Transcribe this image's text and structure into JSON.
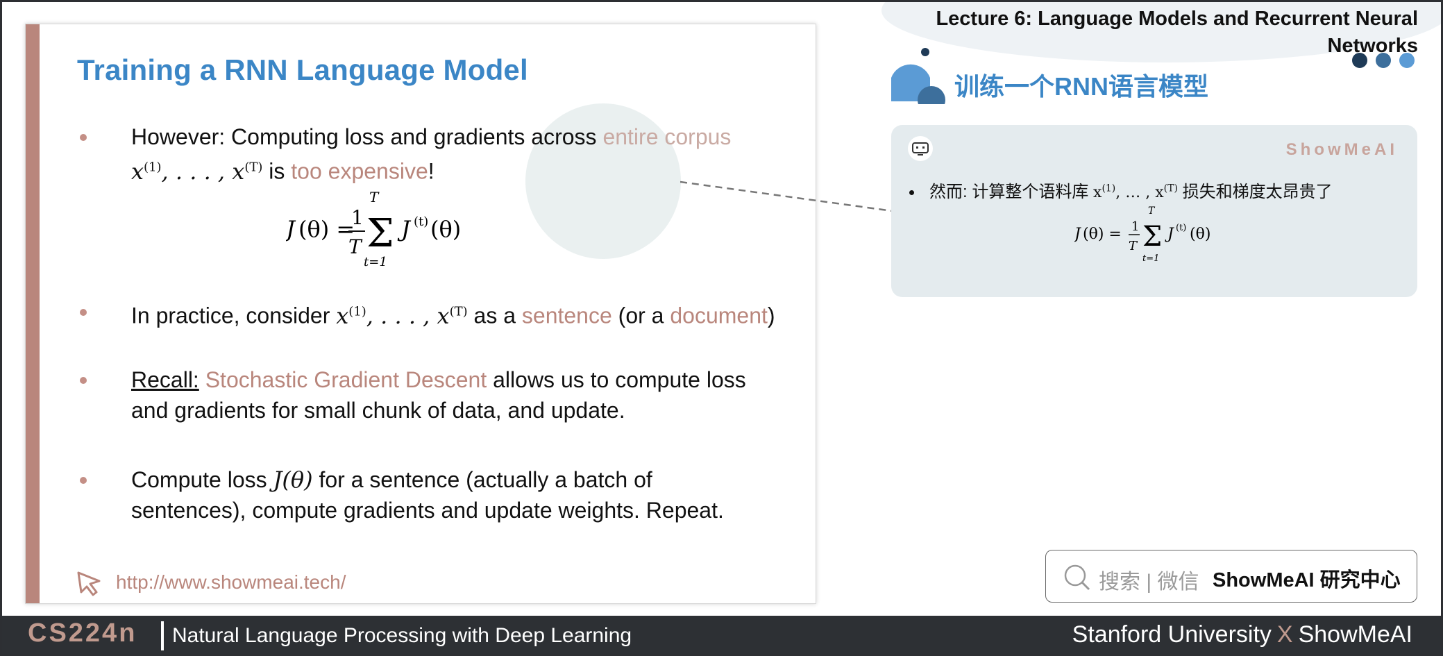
{
  "slide": {
    "title": "Training a RNN Language Model",
    "bullet1": {
      "line1_prefix": "However: Computing loss and gradients across ",
      "line1_highlight": "entire corpus",
      "line2_math": "x(1), . . . , x(T)",
      "line2_mid": " is ",
      "line2_highlight": "too expensive",
      "line2_end": "!"
    },
    "formula": "J(θ) = 1/T Σ_{t=1}^{T} J^{(t)}(θ)",
    "bullet2": {
      "prefix": "In practice, consider ",
      "math": "x(1), . . . , x(T)",
      "mid": " as a ",
      "highlight1": "sentence",
      "mid2": " (or a ",
      "highlight2": "document",
      "end": ")"
    },
    "bullet3": {
      "recall": "Recall:",
      "highlight": "Stochastic Gradient Descent",
      "rest1": " allows us to compute loss",
      "line2": "and gradients for small chunk of data, and update."
    },
    "bullet4": {
      "prefix": "Compute loss ",
      "math": "J(θ)",
      "rest1": " for a sentence (actually a batch of",
      "line2": "sentences), compute gradients and update weights. Repeat."
    },
    "link": "http://www.showmeai.tech/"
  },
  "right": {
    "lecture_title_line1": "Lecture 6:  Language Models and Recurrent Neural",
    "lecture_title_line2": "Networks",
    "cn_title": "训练一个RNN语言模型",
    "brand": "ShowMeAI",
    "card_text_prefix": "然而: 计算整个语料库 ",
    "card_math": "x(1), … , x(T)",
    "card_text_suffix": " 损失和梯度太昂贵了",
    "search_text": "搜索 | 微信",
    "search_brand": "ShowMeAI 研究中心"
  },
  "footer": {
    "course_code": "CS224n",
    "course_name": "Natural Language Processing with Deep Learning",
    "right_left": "Stanford University",
    "right_x": "X",
    "right_right": "ShowMeAI"
  },
  "colors": {
    "accent": "#b9867c",
    "title_blue": "#3b86c6",
    "footer_bg": "#2d3034",
    "card_bg": "#e4ebee"
  }
}
